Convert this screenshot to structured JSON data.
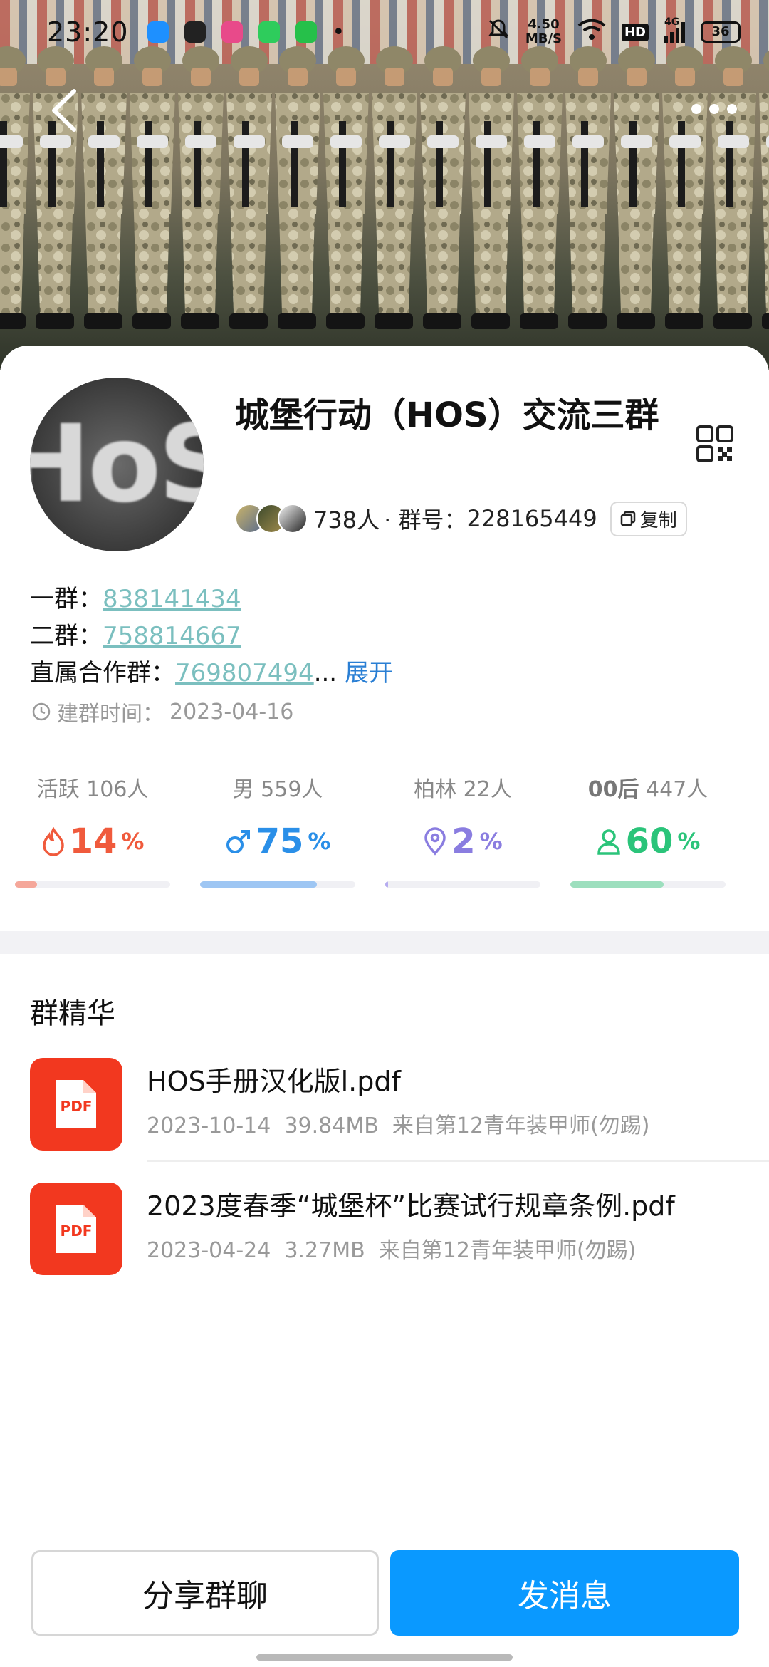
{
  "status_bar": {
    "time": "23:20",
    "net_speed": "4.50",
    "net_unit": "MB/S",
    "hd": "HD",
    "signal": "4G",
    "battery": "36"
  },
  "group": {
    "name": "城堡行动（HOS）交流三群",
    "avatar_text": "HoS",
    "member_count": "738人",
    "id_label": "· 群号：",
    "id": "228165449",
    "copy_label": "复制"
  },
  "links": [
    {
      "label": "一群：",
      "number": "838141434"
    },
    {
      "label": "二群：",
      "number": "758814667"
    },
    {
      "label": "直属合作群：",
      "number": "769807494",
      "ellipsis": "...",
      "expand": "展开"
    }
  ],
  "created": {
    "label": "建群时间：",
    "date": "2023-04-16"
  },
  "stats": [
    {
      "label": "活跃",
      "count": "106人",
      "value": "14",
      "unit": "%",
      "fraction": 0.14,
      "color": "#f05a3c",
      "bar_color": "#f5a79a",
      "icon": "flame-icon"
    },
    {
      "label": "男",
      "count": "559人",
      "value": "75",
      "unit": "%",
      "fraction": 0.75,
      "color": "#2a8fe8",
      "bar_color": "#9ec6f3",
      "icon": "male-icon"
    },
    {
      "label": "柏林",
      "count": "22人",
      "value": "2",
      "unit": "%",
      "fraction": 0.02,
      "color": "#8a7de0",
      "bar_color": "#b6acf0",
      "icon": "location-pin-icon"
    },
    {
      "label": "00后",
      "count": "447人",
      "value": "60",
      "unit": "%",
      "fraction": 0.6,
      "color": "#2bc47a",
      "bar_color": "#9ddfbe",
      "icon": "person-icon"
    }
  ],
  "essence": {
    "title": "群精华",
    "files": [
      {
        "icon_text": "PDF",
        "name": "HOS手册汉化版l.pdf",
        "date": "2023-10-14",
        "size": "39.84MB",
        "source": "来自第12青年装甲师(勿踢)"
      },
      {
        "icon_text": "PDF",
        "name": "2023度春季“城堡杯”比赛试行规章条例.pdf",
        "date": "2023-04-24",
        "size": "3.27MB",
        "source": "来自第12青年装甲师(勿踢)"
      }
    ]
  },
  "buttons": {
    "share": "分享群聊",
    "send": "发消息"
  }
}
